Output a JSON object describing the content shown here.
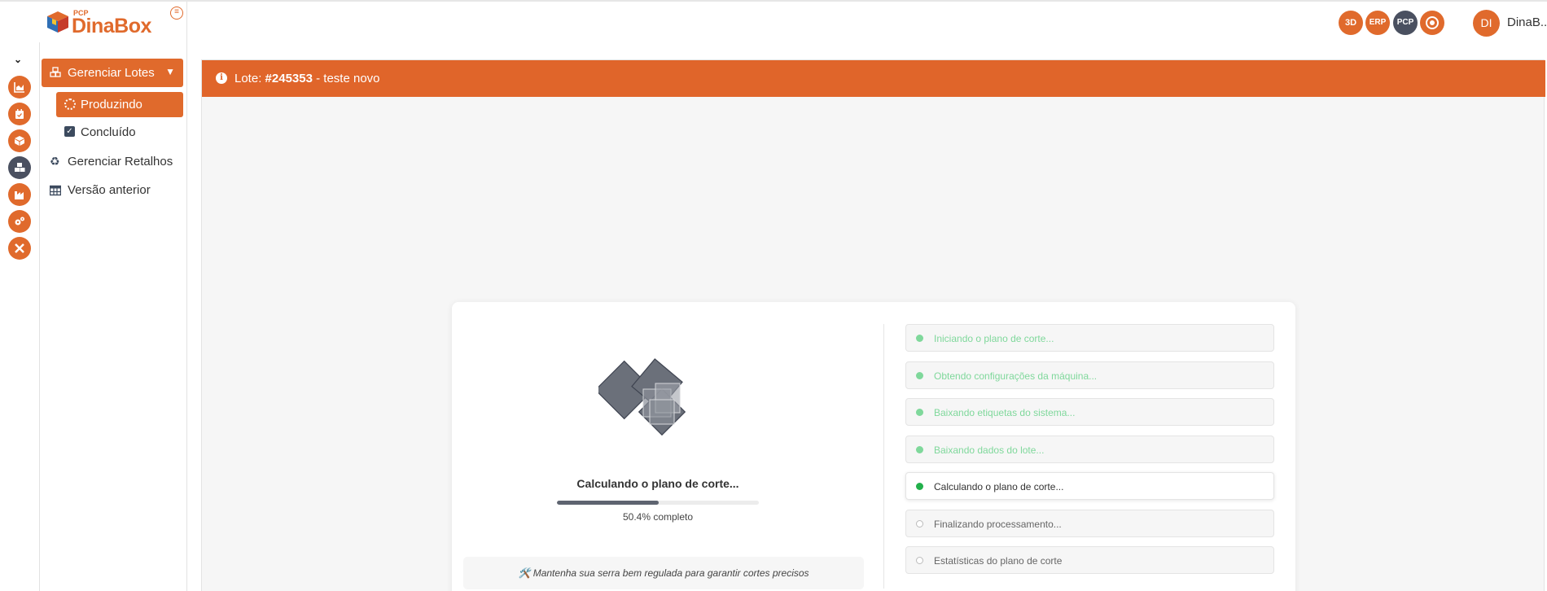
{
  "header": {
    "logo_small": "PCP",
    "logo_text": "DinaBox",
    "apps": [
      "3D",
      "ERP",
      "PCP"
    ],
    "user_initials": "DI",
    "user_name": "DinaB..."
  },
  "sidebar": {
    "main_item": "Gerenciar Lotes",
    "sub_items": [
      {
        "label": "Produzindo",
        "active": true
      },
      {
        "label": "Concluído",
        "active": false
      }
    ],
    "items": [
      {
        "label": "Gerenciar Retalhos"
      },
      {
        "label": "Versão anterior"
      }
    ]
  },
  "banner": {
    "prefix": "Lote:",
    "lot_number": "#245353",
    "suffix": "- teste novo"
  },
  "processing": {
    "title": "Calculando o plano de corte...",
    "progress_percent": 50.4,
    "progress_text": "50.4% completo",
    "tip": "🛠️ Mantenha sua serra bem regulada para garantir cortes precisos",
    "steps": [
      {
        "label": "Iniciando o plano de corte...",
        "status": "done"
      },
      {
        "label": "Obtendo configurações da máquina...",
        "status": "done"
      },
      {
        "label": "Baixando etiquetas do sistema...",
        "status": "done"
      },
      {
        "label": "Baixando dados do lote...",
        "status": "done"
      },
      {
        "label": "Calculando o plano de corte...",
        "status": "current"
      },
      {
        "label": "Finalizando processamento...",
        "status": "pending"
      },
      {
        "label": "Estatísticas do plano de corte",
        "status": "pending"
      }
    ]
  },
  "colors": {
    "accent": "#e0652a",
    "dark": "#4a5060",
    "done": "#7fd89b",
    "current": "#22b04b"
  }
}
